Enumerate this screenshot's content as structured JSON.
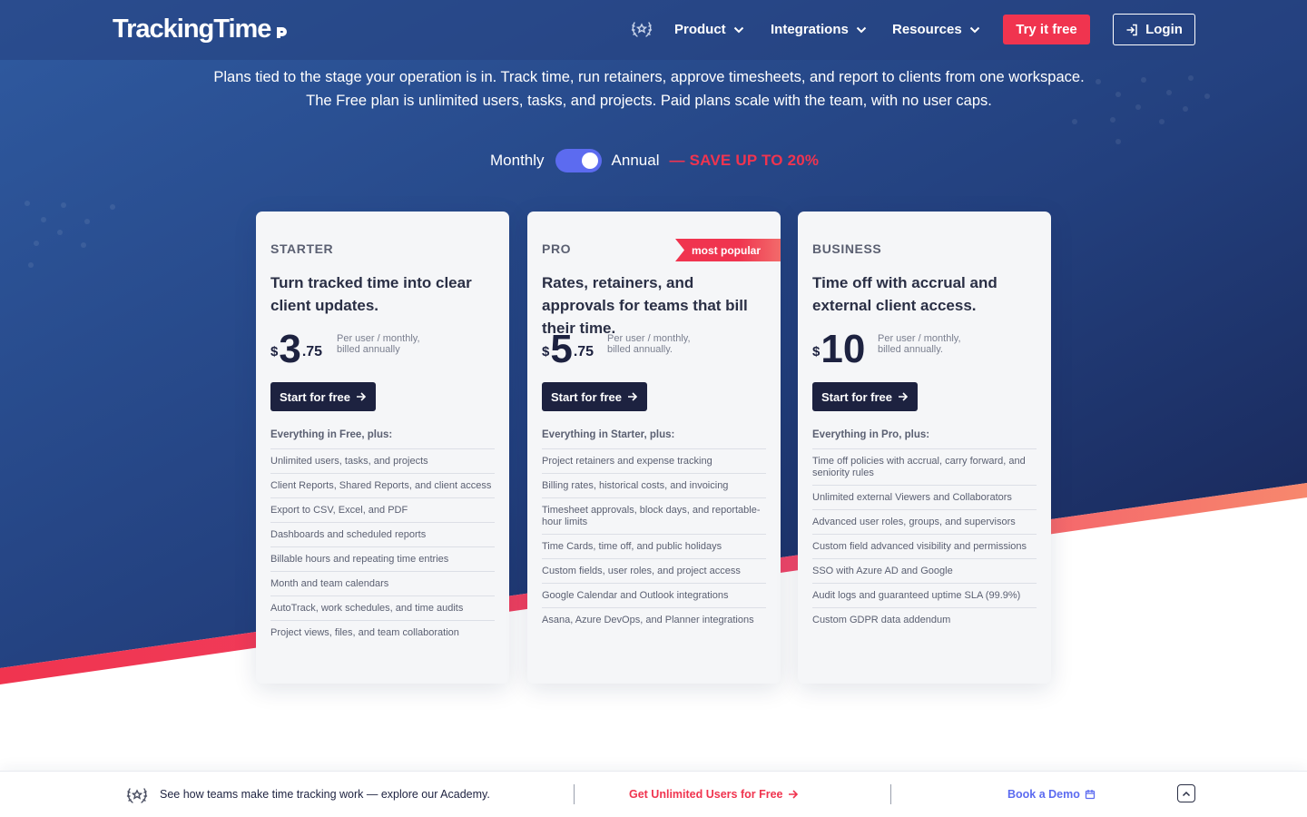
{
  "nav": {
    "brand": "TrackingTime",
    "links": [
      {
        "label": "Product"
      },
      {
        "label": "Integrations"
      },
      {
        "label": "Resources"
      }
    ],
    "try_label": "Try it free",
    "login_label": "Login"
  },
  "intro": {
    "line1": "Plans tied to the stage your operation is in. Track time, run retainers, approve timesheets, and report to clients from one workspace.",
    "line2": "The Free plan is unlimited users, tasks, and projects. Paid plans scale with the team, with no user caps."
  },
  "billing": {
    "monthly": "Monthly",
    "annual": "Annual",
    "save": "— SAVE UP TO 20%",
    "selected": "Annual"
  },
  "plans": [
    {
      "name": "STARTER",
      "headline": "Turn tracked time into clear client updates.",
      "currency": "$",
      "price_int": "3",
      "price_dec": ".75",
      "per": "Per user / monthly, billed annually",
      "cta": "Start for free",
      "features_title": "Everything in Free, plus:",
      "features": [
        "Unlimited users, tasks, and projects",
        "Client Reports, Shared Reports, and client access",
        "Export to CSV, Excel, and PDF",
        "Dashboards and scheduled reports",
        "Billable hours and repeating time entries",
        "Month and team calendars",
        "AutoTrack, work schedules, and time audits",
        "Project views, files, and team collaboration"
      ]
    },
    {
      "name": "PRO",
      "badge": "most popular",
      "headline": "Rates, retainers, and approvals for teams that bill their time.",
      "currency": "$",
      "price_int": "5",
      "price_dec": ".75",
      "per": "Per user / monthly, billed annually.",
      "cta": "Start for free",
      "features_title": "Everything in Starter, plus:",
      "features": [
        "Project retainers and expense tracking",
        "Billing rates, historical costs, and invoicing",
        "Timesheet approvals, block days, and reportable-hour limits",
        "Time Cards, time off, and public holidays",
        "Custom fields, user roles, and project access",
        "Google Calendar and Outlook integrations",
        "Asana, Azure DevOps, and Planner integrations"
      ]
    },
    {
      "name": "BUSINESS",
      "headline": "Time off with accrual and external client access.",
      "currency": "$",
      "price_int": "10",
      "price_dec": "",
      "per": "Per user / monthly, billed annually.",
      "cta": "Start for free",
      "features_title": "Everything in Pro, plus:",
      "features": [
        "Time off policies with accrual, carry forward, and seniority rules",
        "Unlimited external Viewers and Collaborators",
        "Advanced user roles, groups, and supervisors",
        "Custom field advanced visibility and permissions",
        "SSO with Azure AD and Google",
        "Audit logs and guaranteed uptime SLA (99.9%)",
        "Custom GDPR data addendum"
      ]
    }
  ],
  "bottom_bar": {
    "academy_text": "See how teams make time tracking work — explore our Academy.",
    "cta": "Get Unlimited Users for Free",
    "demo": "Book a Demo"
  },
  "colors": {
    "accent_red": "#f0344f",
    "navy": "#1d2240",
    "toggle": "#5c6bf0",
    "hero_top": "#2e5596",
    "hero_bottom": "#1a2550"
  }
}
